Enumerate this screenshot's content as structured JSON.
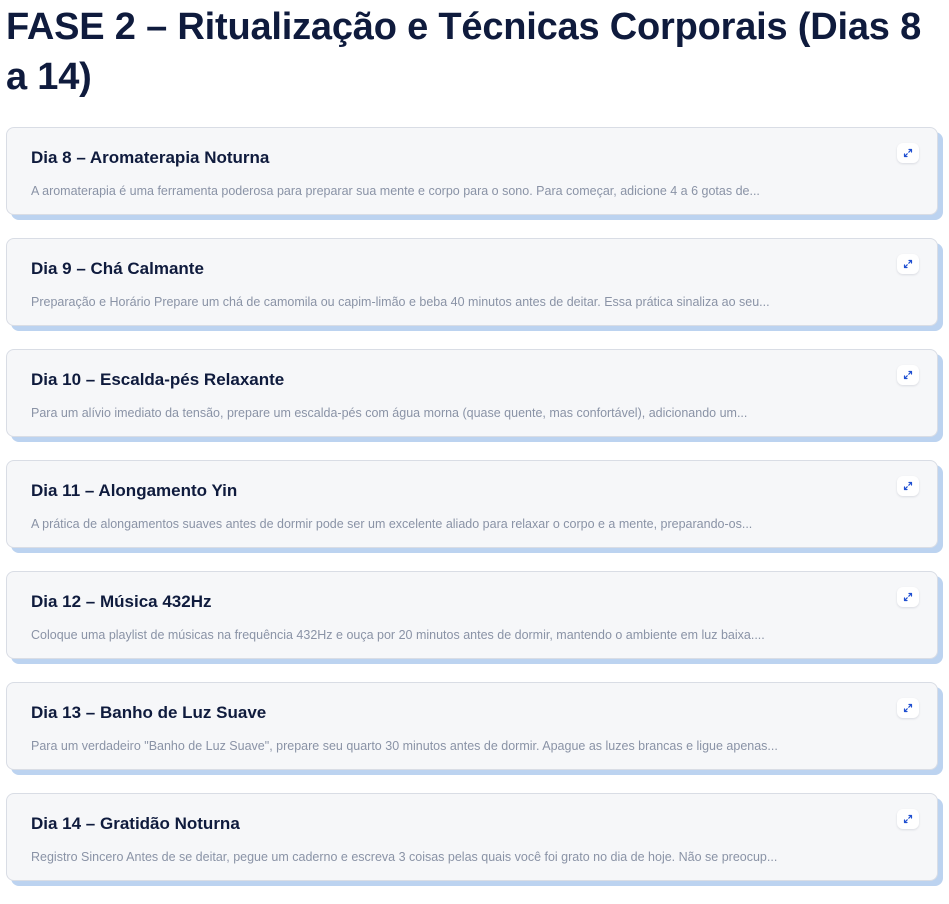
{
  "page": {
    "title": "FASE 2 – Ritualização e Técnicas Corporais (Dias 8 a 14)"
  },
  "cards": [
    {
      "title": "Dia 8 – Aromaterapia Noturna",
      "excerpt": "A aromaterapia é uma ferramenta poderosa para preparar sua mente e corpo para o sono. Para começar, adicione 4 a 6 gotas de..."
    },
    {
      "title": "Dia 9 – Chá Calmante",
      "excerpt": "Preparação e Horário Prepare um chá de camomila ou capim-limão e beba 40 minutos antes de deitar. Essa prática sinaliza ao seu..."
    },
    {
      "title": "Dia 10 – Escalda-pés Relaxante",
      "excerpt": "Para um alívio imediato da tensão, prepare um escalda-pés com água morna (quase quente, mas confortável), adicionando um..."
    },
    {
      "title": "Dia 11 – Alongamento Yin",
      "excerpt": "A prática de alongamentos suaves antes de dormir pode ser um excelente aliado para relaxar o corpo e a mente, preparando-os..."
    },
    {
      "title": "Dia 12 – Música 432Hz",
      "excerpt": "Coloque uma playlist de músicas na frequência 432Hz e ouça por 20 minutos antes de dormir, mantendo o ambiente em luz baixa...."
    },
    {
      "title": "Dia 13 – Banho de Luz Suave",
      "excerpt": "Para um verdadeiro \"Banho de Luz Suave\", prepare seu quarto 30 minutos antes de dormir. Apague as luzes brancas e ligue apenas..."
    },
    {
      "title": "Dia 14 – Gratidão Noturna",
      "excerpt": "Registro Sincero Antes de se deitar, pegue um caderno e escreva 3 coisas pelas quais você foi grato no dia de hoje. Não se preocup..."
    }
  ],
  "icons": {
    "expand": "expand-icon"
  },
  "colors": {
    "title": "#0f1b3d",
    "excerpt": "#8a93a6",
    "card_bg": "#f6f7f9",
    "card_shadow": "#bcd3f0",
    "icon_accent": "#1f4fd1"
  }
}
